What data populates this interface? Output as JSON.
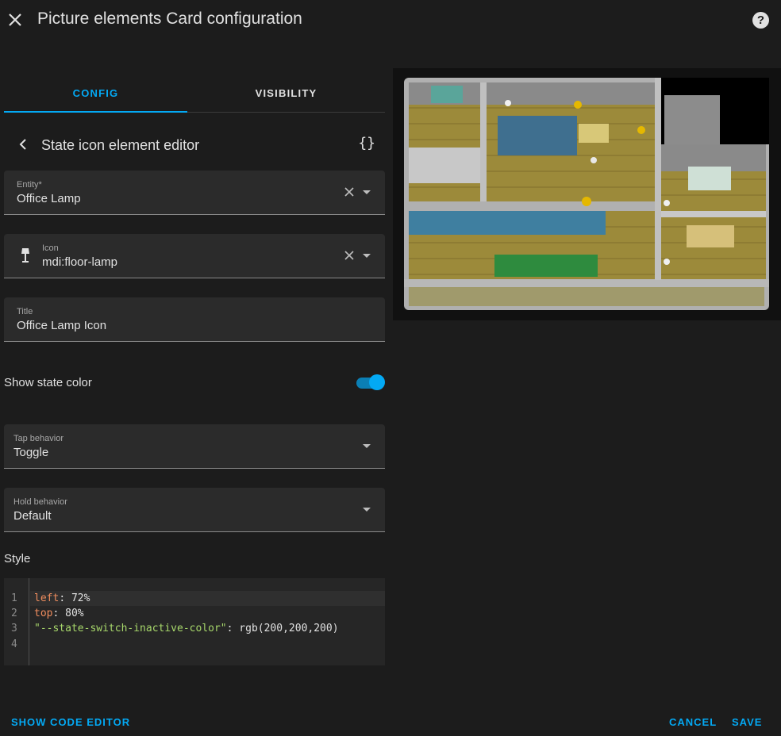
{
  "dialog": {
    "title": "Picture elements Card configuration"
  },
  "tabs": [
    {
      "label": "CONFIG"
    },
    {
      "label": "VISIBILITY"
    }
  ],
  "editor": {
    "title": "State icon element editor",
    "code_toggle": "{}"
  },
  "fields": {
    "entity": {
      "label": "Entity*",
      "value": "Office Lamp"
    },
    "icon": {
      "label": "Icon",
      "value": "mdi:floor-lamp"
    },
    "title": {
      "label": "Title",
      "value": "Office Lamp Icon"
    },
    "tap_behavior": {
      "label": "Tap behavior",
      "value": "Toggle"
    },
    "hold_behavior": {
      "label": "Hold behavior",
      "value": "Default"
    }
  },
  "show_state_color": {
    "label": "Show state color",
    "enabled": true
  },
  "style": {
    "label": "Style",
    "line_numbers": [
      "1",
      "2",
      "3",
      "4"
    ],
    "lines": [
      {
        "key": "left",
        "sep": ": ",
        "value": "72%"
      },
      {
        "key": "top",
        "sep": ": ",
        "value": "80%"
      },
      {
        "key": "\"--state-switch-inactive-color\"",
        "sep": ": ",
        "value": "rgb(200,200,200)"
      }
    ]
  },
  "footer": {
    "show_code_editor": "SHOW CODE EDITOR",
    "cancel": "CANCEL",
    "save": "SAVE"
  },
  "colors": {
    "accent": "#03a9f4",
    "background": "#1c1c1c",
    "field": "#2b2b2b"
  }
}
